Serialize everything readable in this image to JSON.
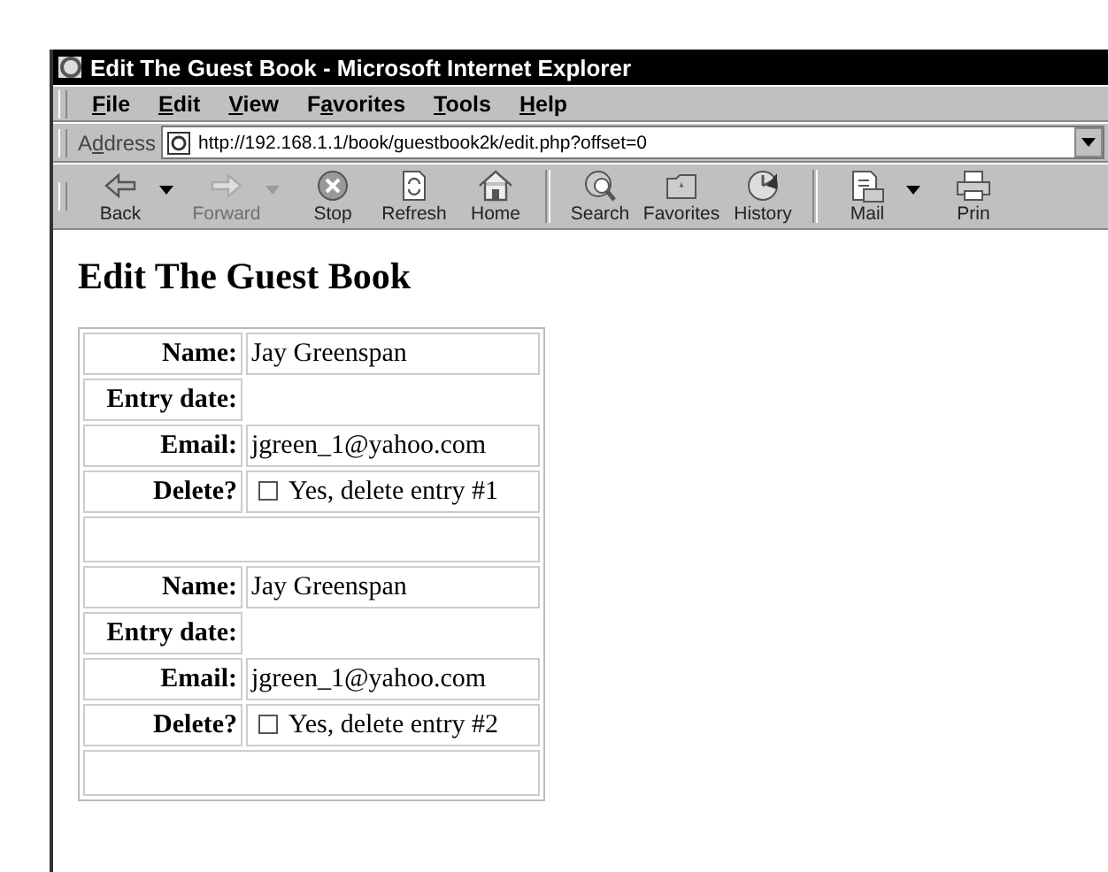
{
  "window": {
    "title": "Edit The Guest Book - Microsoft Internet Explorer"
  },
  "menu": [
    {
      "key": "F",
      "post": "ile"
    },
    {
      "key": "E",
      "post": "dit"
    },
    {
      "key": "V",
      "post": "iew"
    },
    {
      "pre": "F",
      "key": "a",
      "post": "vorites"
    },
    {
      "key": "T",
      "post": "ools"
    },
    {
      "key": "H",
      "post": "elp"
    }
  ],
  "address": {
    "label": {
      "pre": "A",
      "key": "d",
      "post": "dress"
    },
    "value": "http://192.168.1.1/book/guestbook2k/edit.php?offset=0"
  },
  "toolbar": [
    {
      "kind": "back",
      "label": "Back",
      "disabled": false,
      "dropdown": true
    },
    {
      "kind": "forward",
      "label": "Forward",
      "disabled": true,
      "dropdown": true
    },
    {
      "kind": "stop",
      "label": "Stop",
      "disabled": false,
      "dropdown": false
    },
    {
      "kind": "refresh",
      "label": "Refresh",
      "disabled": false,
      "dropdown": false
    },
    {
      "kind": "home",
      "label": "Home",
      "disabled": false,
      "dropdown": false
    },
    {
      "kind": "separator"
    },
    {
      "kind": "search",
      "label": "Search",
      "disabled": false,
      "dropdown": false
    },
    {
      "kind": "favorites",
      "label": "Favorites",
      "disabled": false,
      "dropdown": false
    },
    {
      "kind": "history",
      "label": "History",
      "disabled": false,
      "dropdown": false
    },
    {
      "kind": "separator"
    },
    {
      "kind": "mail",
      "label": "Mail",
      "disabled": false,
      "dropdown": true
    },
    {
      "kind": "print",
      "label": "Prin",
      "disabled": false,
      "dropdown": false
    }
  ],
  "page": {
    "heading": "Edit The Guest Book",
    "entries": [
      {
        "fields": [
          {
            "kind": "text",
            "label": "Name:",
            "value": "Jay Greenspan"
          },
          {
            "kind": "empty",
            "label": "Entry date:"
          },
          {
            "kind": "text",
            "label": "Email:",
            "value": "jgreen_1@yahoo.com"
          },
          {
            "kind": "checkbox",
            "label": "Delete?",
            "value": "Yes, delete entry #1",
            "checked": false
          }
        ]
      },
      {
        "fields": [
          {
            "kind": "text",
            "label": "Name:",
            "value": "Jay Greenspan"
          },
          {
            "kind": "empty",
            "label": "Entry date:"
          },
          {
            "kind": "text",
            "label": "Email:",
            "value": "jgreen_1@yahoo.com"
          },
          {
            "kind": "checkbox",
            "label": "Delete?",
            "value": "Yes, delete entry #2",
            "checked": false
          }
        ]
      }
    ]
  }
}
